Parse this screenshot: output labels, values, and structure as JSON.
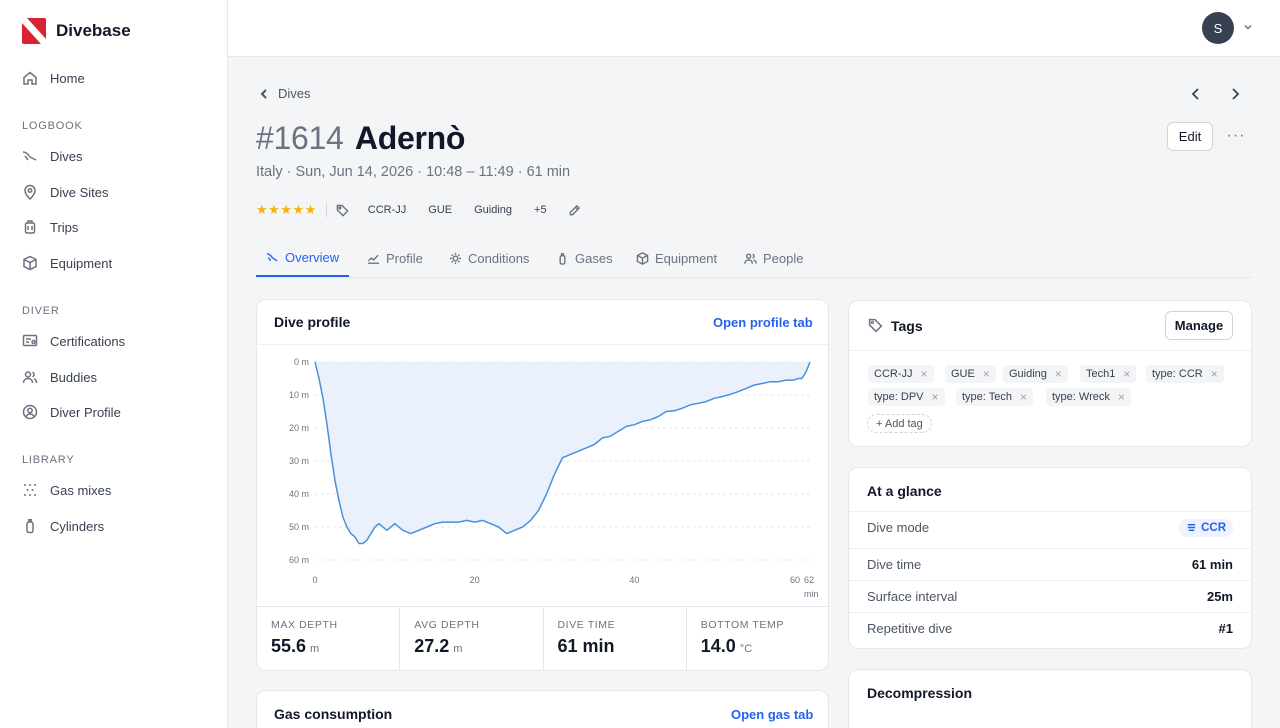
{
  "app": {
    "name": "Divebase"
  },
  "sidebar": {
    "home": "Home",
    "sections": [
      {
        "title": "LOGBOOK",
        "items": [
          "Dives",
          "Dive Sites",
          "Trips",
          "Equipment"
        ]
      },
      {
        "title": "DIVER",
        "items": [
          "Certifications",
          "Buddies",
          "Diver Profile"
        ]
      },
      {
        "title": "LIBRARY",
        "items": [
          "Gas mixes",
          "Cylinders"
        ]
      }
    ]
  },
  "user": {
    "initial": "S"
  },
  "breadcrumb": {
    "back_label": "Dives"
  },
  "dive": {
    "number": "#1614",
    "name": "Adernò",
    "subtitle": "Italy · Sun, Jun 14, 2026 · 10:48 – 11:49 · 61 min",
    "rating": "★★★★★",
    "header_tags": [
      "CCR-JJ",
      "GUE",
      "Guiding",
      "+5"
    ]
  },
  "actions": {
    "edit_label": "Edit",
    "more_label": "···"
  },
  "tabs": [
    {
      "label": "Overview",
      "icon": "dive-icon"
    },
    {
      "label": "Profile",
      "icon": "chart-icon"
    },
    {
      "label": "Conditions",
      "icon": "sun-icon"
    },
    {
      "label": "Gases",
      "icon": "tank-icon"
    },
    {
      "label": "Equipment",
      "icon": "box-icon"
    },
    {
      "label": "People",
      "icon": "people-icon"
    }
  ],
  "profile_card": {
    "title": "Dive profile",
    "link": "Open profile tab",
    "stats": [
      {
        "label": "MAX DEPTH",
        "value": "55.6",
        "unit": "m"
      },
      {
        "label": "AVG DEPTH",
        "value": "27.2",
        "unit": "m"
      },
      {
        "label": "DIVE TIME",
        "value": "61 min",
        "unit": ""
      },
      {
        "label": "BOTTOM TEMP",
        "value": "14.0",
        "unit": "°C"
      }
    ]
  },
  "chart_data": {
    "type": "area",
    "xlabel": "min",
    "ylabel": "",
    "xlim": [
      0,
      62
    ],
    "ylim": [
      0,
      60
    ],
    "y_inverted": true,
    "x_ticks": [
      "0",
      "20",
      "40",
      "60",
      "62"
    ],
    "y_ticks": [
      "0 m",
      "10 m",
      "20 m",
      "30 m",
      "40 m",
      "50 m",
      "60 m"
    ],
    "grid": true,
    "series": [
      {
        "x": [
          0,
          0.5,
          1,
          1.5,
          2,
          2.5,
          3,
          3.5,
          4,
          4.5,
          5,
          5.5,
          6,
          6.5,
          7,
          7.5,
          8,
          9,
          10,
          11,
          12,
          13,
          14,
          15,
          16,
          17,
          18,
          19,
          20,
          21,
          22,
          23,
          24,
          25,
          26,
          27,
          28,
          29,
          30,
          31,
          32,
          33,
          34,
          35,
          36,
          37,
          38,
          39,
          40,
          41,
          42,
          43,
          44,
          45,
          46,
          47,
          48,
          49,
          50,
          51,
          52,
          53,
          54,
          55,
          56,
          57,
          58,
          59,
          60,
          60.5,
          61,
          61.5,
          62
        ],
        "y": [
          0,
          5,
          11,
          19,
          28,
          36,
          42,
          47,
          50,
          52,
          53,
          55,
          55,
          54,
          52,
          50,
          49,
          51,
          49,
          51,
          52,
          51,
          50,
          49,
          48.5,
          48.5,
          48.5,
          48,
          48.5,
          48,
          49,
          50,
          52,
          51,
          50,
          48,
          45,
          40,
          34,
          29,
          28,
          27,
          26,
          25,
          23,
          22.5,
          21,
          19.5,
          19,
          18,
          17.5,
          16.5,
          15,
          14.8,
          14,
          13,
          12.5,
          12,
          11,
          10.5,
          9.8,
          9,
          8,
          7,
          6.5,
          6,
          6,
          5.5,
          5.5,
          5,
          5,
          3,
          0
        ]
      }
    ]
  },
  "gas_card": {
    "title": "Gas consumption",
    "link": "Open gas tab"
  },
  "tags_card": {
    "title": "Tags",
    "manage_label": "Manage",
    "tags": [
      "CCR-JJ",
      "GUE",
      "Guiding",
      "Tech1",
      "type: CCR",
      "type: DPV",
      "type: Tech",
      "type: Wreck"
    ],
    "remove_glyph": "×",
    "add_label": "+ Add tag"
  },
  "glance_card": {
    "title": "At a glance",
    "rows": [
      {
        "label": "Dive mode",
        "value": "CCR"
      },
      {
        "label": "Dive time",
        "value": "61 min"
      },
      {
        "label": "Surface interval",
        "value": "25m"
      },
      {
        "label": "Repetitive dive",
        "value": "#1"
      }
    ]
  },
  "deco_card": {
    "title": "Decompression"
  },
  "colors": {
    "accent": "#2563eb",
    "chart_line": "#4a90d9",
    "chart_fill": "#eaf1fc",
    "star": "#f5b301",
    "logo_red": "#d92332"
  }
}
